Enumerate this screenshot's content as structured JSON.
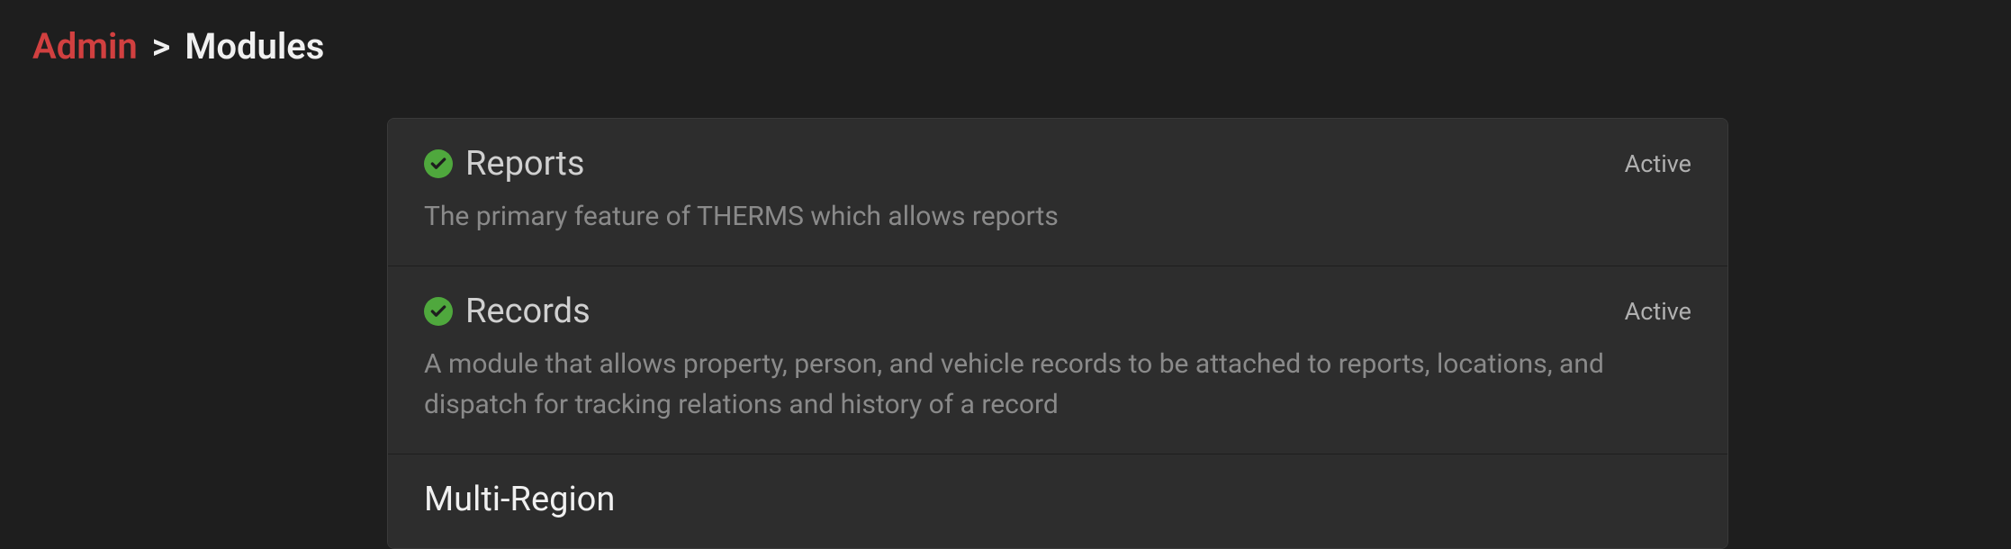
{
  "breadcrumb": {
    "admin": "Admin",
    "separator": ">",
    "current": "Modules"
  },
  "modules": [
    {
      "title": "Reports",
      "status": "Active",
      "has_check": true,
      "description": "The primary feature of THERMS which allows reports"
    },
    {
      "title": "Records",
      "status": "Active",
      "has_check": true,
      "description": "A module that allows property, person, and vehicle records to be attached to reports, locations, and dispatch for tracking relations and history of a record"
    },
    {
      "title": "Multi-Region",
      "status": "",
      "has_check": false,
      "description": ""
    }
  ]
}
